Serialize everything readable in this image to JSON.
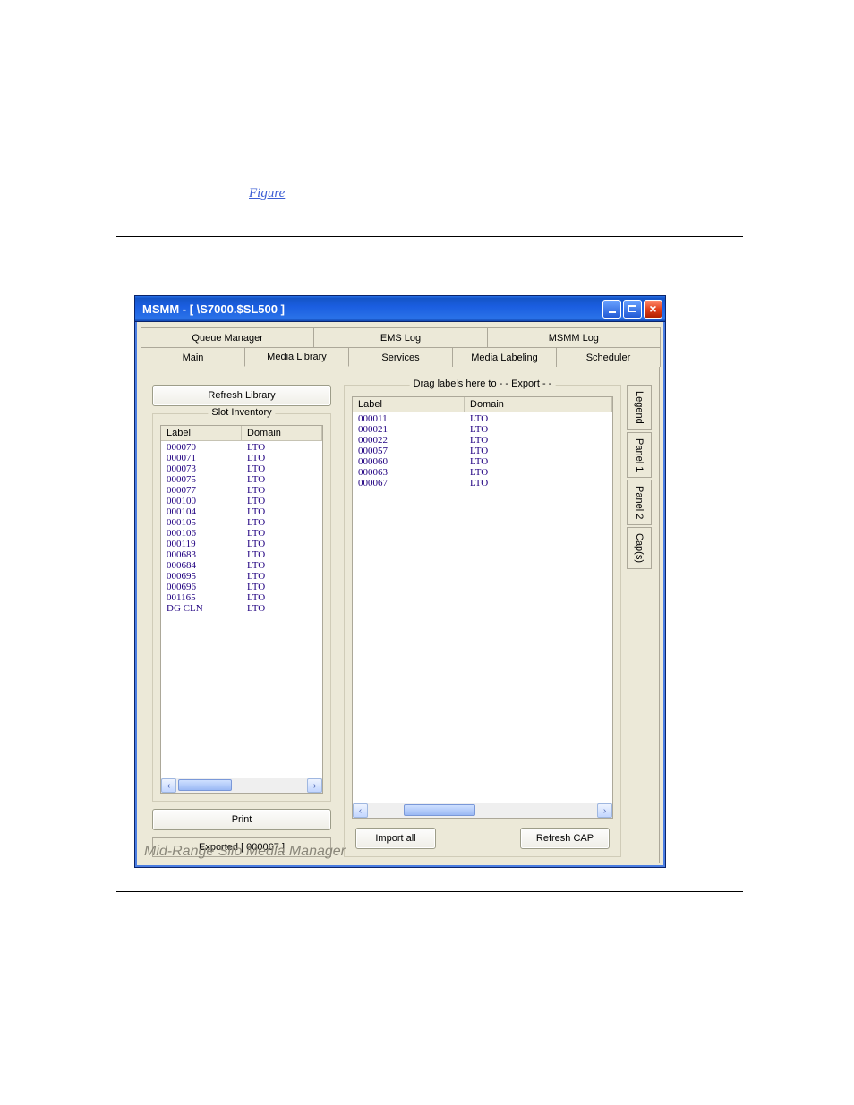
{
  "page_link_text": "Figure",
  "window": {
    "title": "MSMM - [ \\S7000.$SL500 ]"
  },
  "tabs_back": [
    "Queue Manager",
    "EMS Log",
    "MSMM Log"
  ],
  "tabs_front": [
    "Main",
    "Media Library",
    "Services",
    "Media Labeling",
    "Scheduler"
  ],
  "selected_tab": 1,
  "buttons": {
    "refresh_library": "Refresh Library",
    "print": "Print",
    "import_all": "Import all",
    "refresh_cap": "Refresh CAP"
  },
  "groups": {
    "slot_inventory": "Slot Inventory",
    "export_drop": "Drag labels here to  - - Export - -"
  },
  "columns": {
    "label": "Label",
    "domain": "Domain"
  },
  "slot_inventory": [
    {
      "label": "000070",
      "domain": "LTO"
    },
    {
      "label": "000071",
      "domain": "LTO"
    },
    {
      "label": "000073",
      "domain": "LTO"
    },
    {
      "label": "000075",
      "domain": "LTO"
    },
    {
      "label": "000077",
      "domain": "LTO"
    },
    {
      "label": "000100",
      "domain": "LTO"
    },
    {
      "label": "000104",
      "domain": "LTO"
    },
    {
      "label": "000105",
      "domain": "LTO"
    },
    {
      "label": "000106",
      "domain": "LTO"
    },
    {
      "label": "000119",
      "domain": "LTO"
    },
    {
      "label": "000683",
      "domain": "LTO"
    },
    {
      "label": "000684",
      "domain": "LTO"
    },
    {
      "label": "000695",
      "domain": "LTO"
    },
    {
      "label": "000696",
      "domain": "LTO"
    },
    {
      "label": "001165",
      "domain": "LTO"
    },
    {
      "label": "DG CLN",
      "domain": "LTO"
    }
  ],
  "export_list": [
    {
      "label": "000011",
      "domain": "LTO"
    },
    {
      "label": "000021",
      "domain": "LTO"
    },
    {
      "label": "000022",
      "domain": "LTO"
    },
    {
      "label": "000057",
      "domain": "LTO"
    },
    {
      "label": "000060",
      "domain": "LTO"
    },
    {
      "label": "000063",
      "domain": "LTO"
    },
    {
      "label": "000067",
      "domain": "LTO"
    }
  ],
  "status_text": "Exported [ 000067 ]",
  "side_tabs": [
    "Legend",
    "Panel 1",
    "Panel 2",
    "Cap(s)"
  ],
  "footer_text": "Mid-Range Silo Media Manager"
}
